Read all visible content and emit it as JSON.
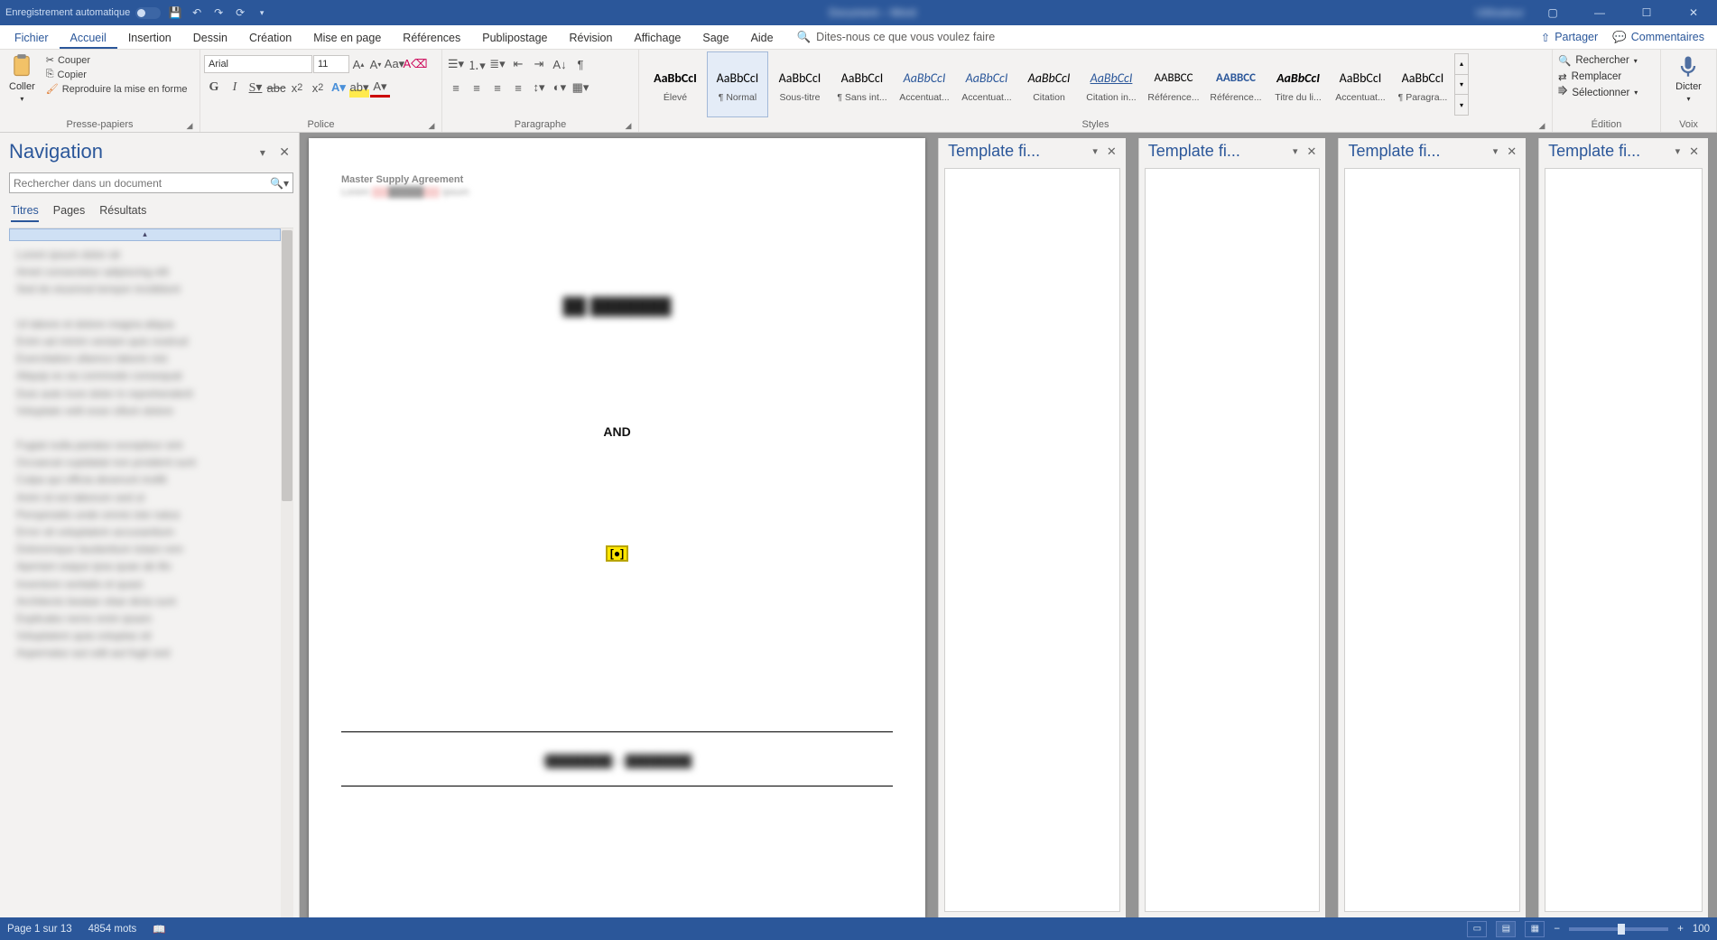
{
  "titlebar": {
    "autosave": "Enregistrement automatique",
    "center": "Document – Word",
    "user": "Utilisateur"
  },
  "ribbon_tabs": {
    "file": "Fichier",
    "home": "Accueil",
    "insert": "Insertion",
    "design": "Dessin",
    "create": "Création",
    "layout": "Mise en page",
    "references": "Références",
    "mailings": "Publipostage",
    "review": "Révision",
    "view": "Affichage",
    "sage": "Sage",
    "help": "Aide",
    "tellme": "Dites-nous ce que vous voulez faire",
    "share": "Partager",
    "comments": "Commentaires"
  },
  "clipboard": {
    "paste": "Coller",
    "cut": "Couper",
    "copy": "Copier",
    "format": "Reproduire la mise en forme",
    "label": "Presse-papiers"
  },
  "font": {
    "name": "Arial",
    "size": "11",
    "label": "Police"
  },
  "para": {
    "label": "Paragraphe"
  },
  "styles": {
    "label": "Styles",
    "items": [
      {
        "sample": "AaBbCcI",
        "name": "Élevé",
        "bold": true
      },
      {
        "sample": "AaBbCcI",
        "name": "¶ Normal",
        "sel": true
      },
      {
        "sample": "AaBbCcI",
        "name": "Sous-titre"
      },
      {
        "sample": "AaBbCcI",
        "name": "¶ Sans int..."
      },
      {
        "sample": "AaBbCcI",
        "name": "Accentuat...",
        "italic": true,
        "color": "#2b579a"
      },
      {
        "sample": "AaBbCcI",
        "name": "Accentuat...",
        "italic": true,
        "color": "#2b579a"
      },
      {
        "sample": "AaBbCcI",
        "name": "Citation",
        "italic": true
      },
      {
        "sample": "AaBbCcI",
        "name": "Citation in...",
        "italic": true,
        "color": "#2b579a",
        "underline": true
      },
      {
        "sample": "AABBCC",
        "name": "Référence...",
        "smallcaps": true
      },
      {
        "sample": "AABBCC",
        "name": "Référence...",
        "smallcaps": true,
        "color": "#2b579a",
        "bold": true
      },
      {
        "sample": "AaBbCcI",
        "name": "Titre du li...",
        "bold": true,
        "italic": true
      },
      {
        "sample": "AaBbCcI",
        "name": "Accentuat..."
      },
      {
        "sample": "AaBbCcI",
        "name": "¶ Paragra..."
      }
    ]
  },
  "editing": {
    "find": "Rechercher",
    "replace": "Remplacer",
    "select": "Sélectionner",
    "label": "Édition"
  },
  "voice": {
    "dictate": "Dicter",
    "label": "Voix"
  },
  "nav": {
    "title": "Navigation",
    "placeholder": "Rechercher dans un document",
    "tabs": {
      "titles": "Titres",
      "pages": "Pages",
      "results": "Résultats"
    }
  },
  "doc": {
    "header": "Master Supply Agreement",
    "and": "AND",
    "mark": "[●]"
  },
  "tpl": {
    "title": "Template fi..."
  },
  "status": {
    "page": "Page 1 sur 13",
    "words": "4854 mots",
    "zoom": "100"
  }
}
